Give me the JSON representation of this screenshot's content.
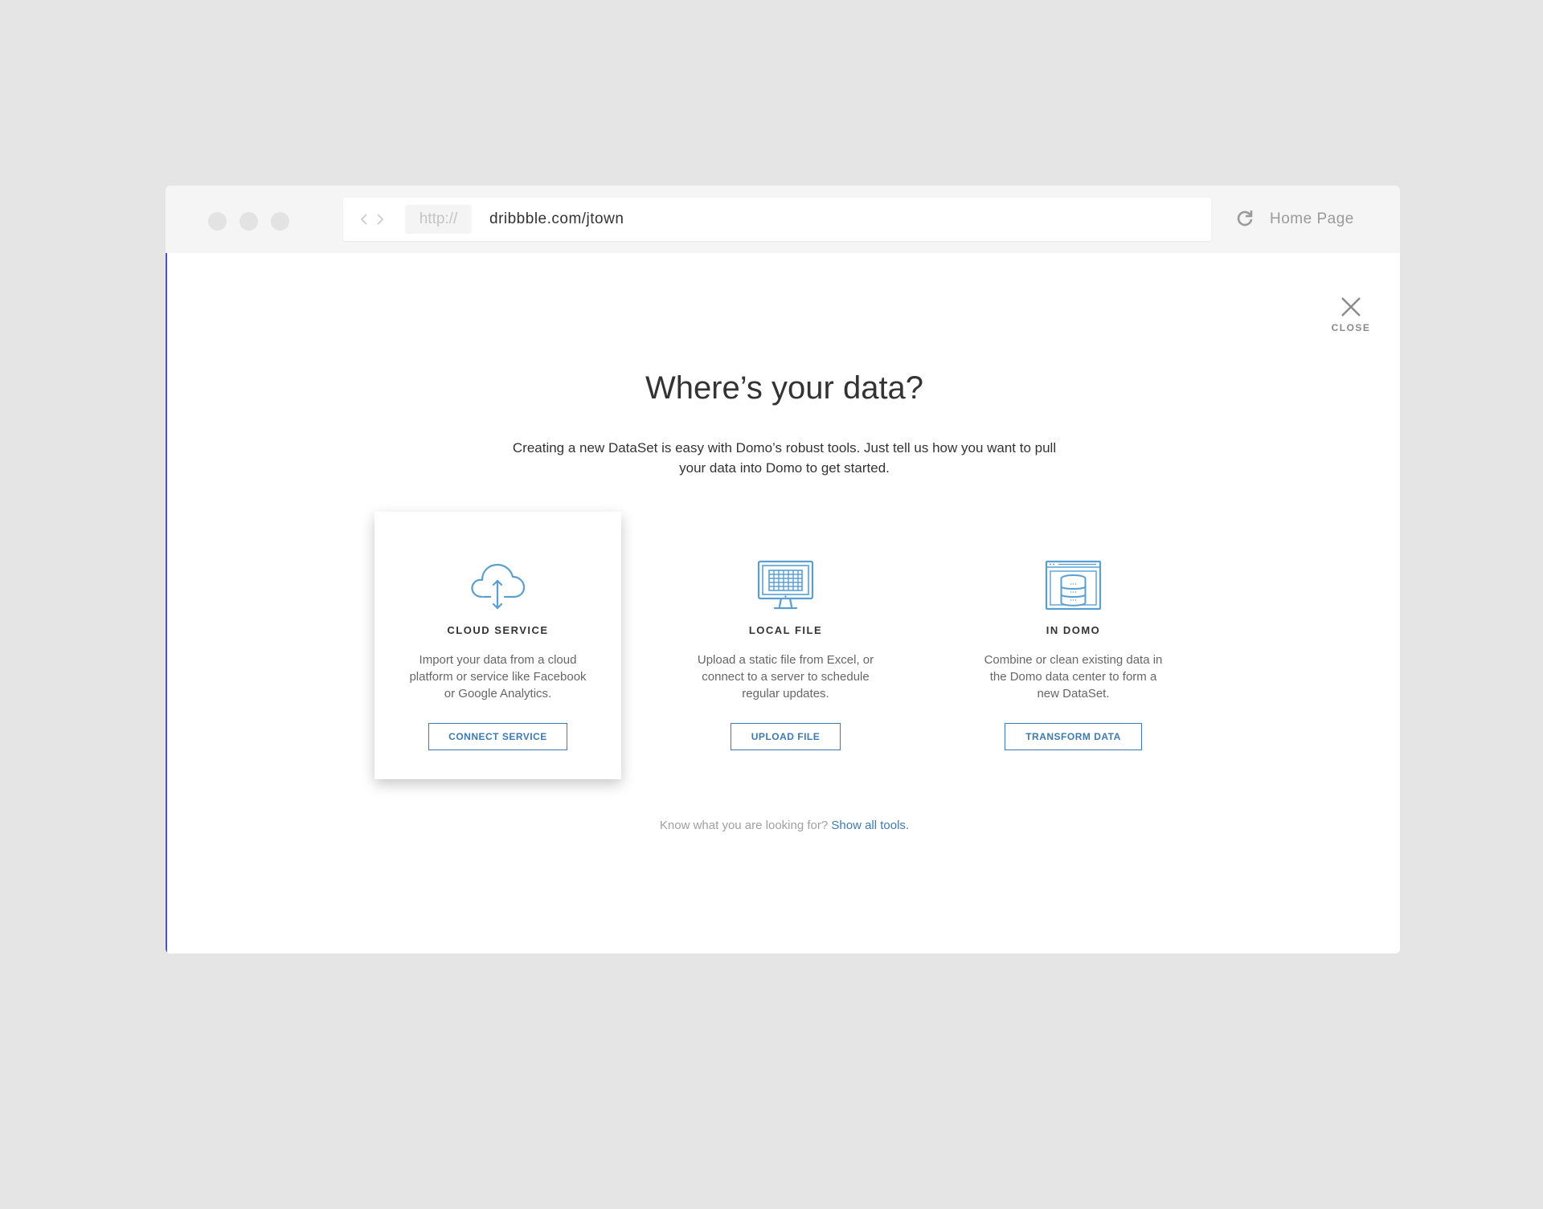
{
  "browser": {
    "protocol": "http://",
    "url": "dribbble.com/jtown",
    "home_label": "Home Page"
  },
  "dialog": {
    "close_label": "CLOSE",
    "title": "Where’s your data?",
    "subtitle": "Creating a new DataSet is easy with Domo’s robust tools. Just tell us how you want to pull your data into Domo to get started."
  },
  "cards": [
    {
      "title": "CLOUD SERVICE",
      "description": "Import your data from a cloud platform or service like Facebook or Google Analytics.",
      "button": "CONNECT SERVICE",
      "icon": "cloud-upload-icon"
    },
    {
      "title": "LOCAL FILE",
      "description": "Upload a static file from Excel, or connect to a server to schedule regular updates.",
      "button": "UPLOAD FILE",
      "icon": "monitor-spreadsheet-icon"
    },
    {
      "title": "IN DOMO",
      "description": "Combine or clean existing data in the Domo data center to form a new DataSet.",
      "button": "TRANSFORM DATA",
      "icon": "database-window-icon"
    }
  ],
  "footer": {
    "prompt": "Know what you are looking for?",
    "link": "Show all tools."
  },
  "colors": {
    "accent": "#3c7bb5",
    "background": "#e5e5e5",
    "chrome": "#f5f5f5"
  }
}
